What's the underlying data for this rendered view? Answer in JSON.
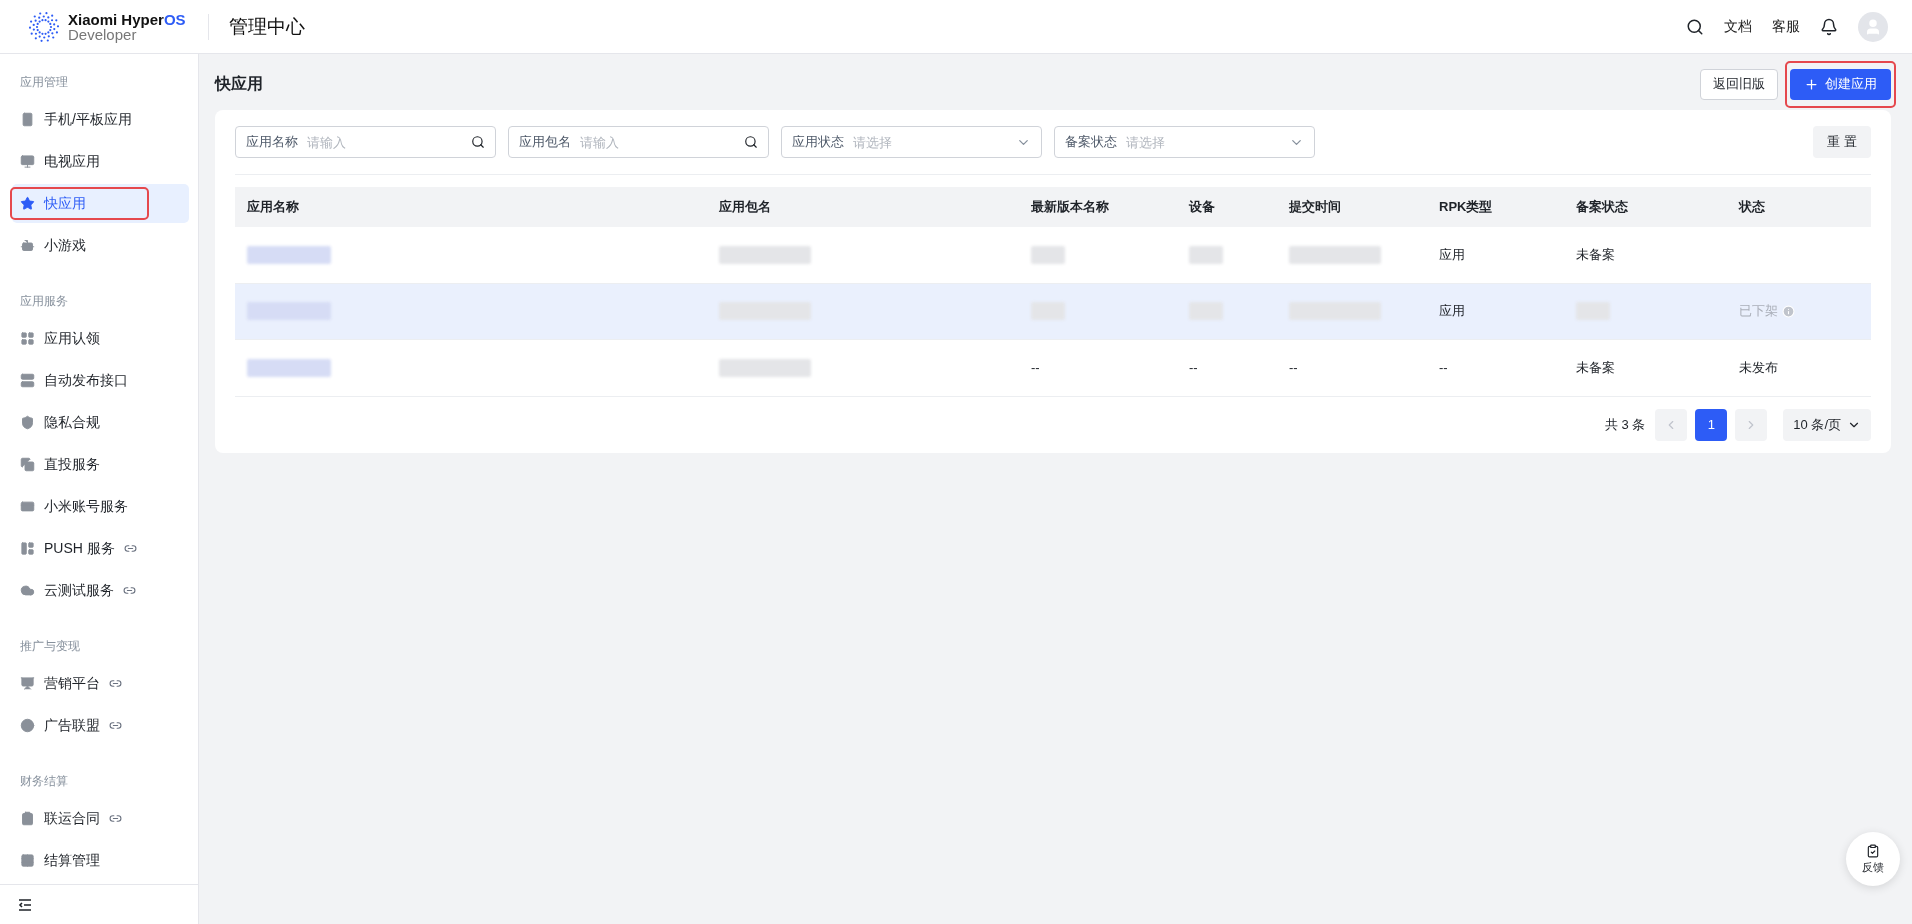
{
  "header": {
    "logo": {
      "name": "Xiaomi Hyper",
      "accent": "OS",
      "sub": "Developer"
    },
    "title": "管理中心",
    "links": [
      "文档",
      "客服"
    ]
  },
  "sidebar": {
    "groups": [
      {
        "label": "应用管理",
        "items": [
          {
            "label": "手机/平板应用",
            "selected": false,
            "link": false,
            "highlighted": false
          },
          {
            "label": "电视应用",
            "selected": false,
            "link": false,
            "highlighted": false
          },
          {
            "label": "快应用",
            "selected": true,
            "link": false,
            "highlighted": true
          },
          {
            "label": "小游戏",
            "selected": false,
            "link": false,
            "highlighted": false
          }
        ]
      },
      {
        "label": "应用服务",
        "items": [
          {
            "label": "应用认领",
            "selected": false,
            "link": false,
            "highlighted": false
          },
          {
            "label": "自动发布接口",
            "selected": false,
            "link": false,
            "highlighted": false
          },
          {
            "label": "隐私合规",
            "selected": false,
            "link": false,
            "highlighted": false
          },
          {
            "label": "直投服务",
            "selected": false,
            "link": false,
            "highlighted": false
          },
          {
            "label": "小米账号服务",
            "selected": false,
            "link": false,
            "highlighted": false
          },
          {
            "label": "PUSH 服务",
            "selected": false,
            "link": true,
            "highlighted": false
          },
          {
            "label": "云测试服务",
            "selected": false,
            "link": true,
            "highlighted": false
          }
        ]
      },
      {
        "label": "推广与变现",
        "items": [
          {
            "label": "营销平台",
            "selected": false,
            "link": true,
            "highlighted": false
          },
          {
            "label": "广告联盟",
            "selected": false,
            "link": true,
            "highlighted": false
          }
        ]
      },
      {
        "label": "财务结算",
        "items": [
          {
            "label": "联运合同",
            "selected": false,
            "link": true,
            "highlighted": false
          },
          {
            "label": "结算管理",
            "selected": false,
            "link": false,
            "highlighted": false
          }
        ]
      }
    ]
  },
  "page": {
    "title": "快应用",
    "old_version_button": "返回旧版",
    "create_button": {
      "label": "创建应用",
      "highlighted": true
    }
  },
  "filters": [
    {
      "kind": "search",
      "label": "应用名称",
      "placeholder": "请输入"
    },
    {
      "kind": "search",
      "label": "应用包名",
      "placeholder": "请输入"
    },
    {
      "kind": "select",
      "label": "应用状态",
      "placeholder": "请选择"
    },
    {
      "kind": "select",
      "label": "备案状态",
      "placeholder": "请选择"
    }
  ],
  "reset_button": "重 置",
  "table": {
    "columns": [
      "应用名称",
      "应用包名",
      "最新版本名称",
      "设备",
      "提交时间",
      "RPK类型",
      "备案状态",
      "状态"
    ],
    "rows": [
      {
        "selected": false,
        "cells": [
          {
            "kind": "blurred"
          },
          {
            "kind": "blurred"
          },
          {
            "kind": "blurred"
          },
          {
            "kind": "blurred"
          },
          {
            "kind": "blurred"
          },
          {
            "kind": "text",
            "text": "应用"
          },
          {
            "kind": "text",
            "text": "未备案"
          },
          {
            "kind": "empty"
          }
        ]
      },
      {
        "selected": true,
        "cells": [
          {
            "kind": "blurred"
          },
          {
            "kind": "blurred"
          },
          {
            "kind": "blurred"
          },
          {
            "kind": "blurred"
          },
          {
            "kind": "blurred"
          },
          {
            "kind": "text",
            "text": "应用"
          },
          {
            "kind": "blurred"
          },
          {
            "kind": "muted-info",
            "text": "已下架"
          }
        ]
      },
      {
        "selected": false,
        "cells": [
          {
            "kind": "blurred"
          },
          {
            "kind": "blurred"
          },
          {
            "kind": "text",
            "text": "--"
          },
          {
            "kind": "text",
            "text": "--"
          },
          {
            "kind": "text",
            "text": "--"
          },
          {
            "kind": "text",
            "text": "--"
          },
          {
            "kind": "text",
            "text": "未备案"
          },
          {
            "kind": "text",
            "text": "未发布"
          }
        ]
      }
    ]
  },
  "pagination": {
    "total": "共 3 条",
    "pages": [
      {
        "label": "1",
        "selected": true
      }
    ],
    "page_size": "10 条/页"
  },
  "feedback_button": "反馈"
}
